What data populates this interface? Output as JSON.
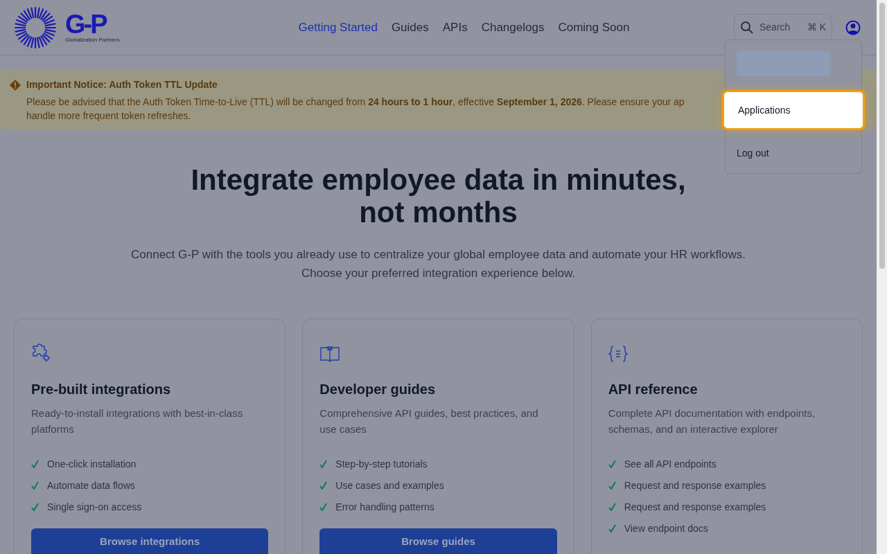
{
  "header": {
    "logo": {
      "wordmark": "G-P",
      "tagline": "Globalization Partners"
    },
    "nav": [
      {
        "label": "Getting Started",
        "selected": true
      },
      {
        "label": "Guides",
        "selected": false
      },
      {
        "label": "APIs",
        "selected": false
      },
      {
        "label": "Changelogs",
        "selected": false
      },
      {
        "label": "Coming Soon",
        "selected": false
      }
    ],
    "search": {
      "placeholder": "Search",
      "shortcut": "⌘ K"
    }
  },
  "account_menu": {
    "items": [
      {
        "kind": "skeleton"
      },
      {
        "kind": "item",
        "label": "Applications",
        "focused": true
      },
      {
        "kind": "item",
        "label": "Log out",
        "focused": false
      }
    ]
  },
  "notice": {
    "title": "Important Notice: Auth Token TTL Update",
    "lines": [
      "Please be advised that the Auth Token Time-to-Live (TTL) will be changed from **24 hours to 1 hour**, effective **September 1, 2026**. Please ensure your ap",
      "handle more frequent token refreshes."
    ]
  },
  "hero": {
    "title_lines": [
      "Integrate employee data in minutes,",
      "not months"
    ],
    "subtitle_lines": [
      "Connect G-P with the tools you already use to centralize your global employee data and automate your HR workflows.",
      "Choose your preferred integration experience below."
    ]
  },
  "cards": [
    {
      "title": "Pre-built integrations",
      "description": "Ready-to-install integrations with best-in-class platforms",
      "features": [
        "One-click installation",
        "Automate data flows",
        "Single sign-on access"
      ],
      "button": "Browse integrations"
    },
    {
      "title": "Developer guides",
      "description": "Comprehensive API guides, best practices, and use cases",
      "features": [
        "Step-by-step tutorials",
        "Use cases and examples",
        "Error handling patterns"
      ],
      "button": "Browse guides"
    },
    {
      "title": "API reference",
      "description": "Complete API documentation with endpoints, schemas, and an interactive explorer",
      "features": [
        "See all API endpoints",
        "Request and response examples",
        "Request and response examples",
        "View endpoint docs"
      ]
    }
  ]
}
